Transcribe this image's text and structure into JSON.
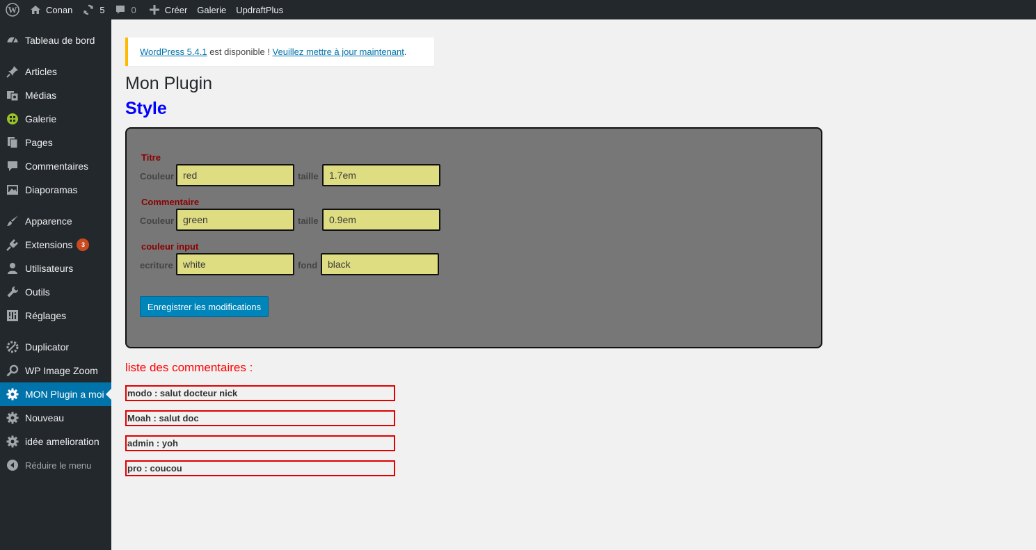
{
  "adminbar": {
    "site_name": "Conan",
    "updates_count": "5",
    "comments_count": "0",
    "new_label": "Créer",
    "galerie_label": "Galerie",
    "updraft_label": "UpdraftPlus"
  },
  "sidebar": {
    "items": [
      {
        "label": "Tableau de bord",
        "icon": "dashboard-icon"
      },
      {
        "label": "Articles",
        "icon": "pin-icon"
      },
      {
        "label": "Médias",
        "icon": "media-icon"
      },
      {
        "label": "Galerie",
        "icon": "gallery-icon"
      },
      {
        "label": "Pages",
        "icon": "pages-icon"
      },
      {
        "label": "Commentaires",
        "icon": "comments-icon"
      },
      {
        "label": "Diaporamas",
        "icon": "slideshow-icon"
      },
      {
        "label": "Apparence",
        "icon": "brush-icon"
      },
      {
        "label": "Extensions",
        "icon": "plugin-icon",
        "badge": "3"
      },
      {
        "label": "Utilisateurs",
        "icon": "user-icon"
      },
      {
        "label": "Outils",
        "icon": "wrench-icon"
      },
      {
        "label": "Réglages",
        "icon": "settings-icon"
      },
      {
        "label": "Duplicator",
        "icon": "duplicator-icon"
      },
      {
        "label": "WP Image Zoom",
        "icon": "zoom-icon"
      },
      {
        "label": "MON Plugin a moi",
        "icon": "gear-icon",
        "current": true
      },
      {
        "label": "Nouveau",
        "icon": "gear-icon"
      },
      {
        "label": "idée amelioration",
        "icon": "gear-icon"
      },
      {
        "label": "Réduire le menu",
        "icon": "collapse-icon"
      }
    ]
  },
  "notice": {
    "version_link": "WordPress 5.4.1",
    "middle_text": " est disponible ! ",
    "update_link": "Veuillez mettre à jour maintenant",
    "end_text": "."
  },
  "page": {
    "title": "Mon Plugin",
    "subtitle": "Style"
  },
  "form": {
    "titre": {
      "heading": "Titre",
      "color_label": "Couleur",
      "color_value": "red",
      "size_label": "taille",
      "size_value": "1.7em"
    },
    "commentaire": {
      "heading": "Commentaire",
      "color_label": "Couleur",
      "color_value": "green",
      "size_label": "taille",
      "size_value": "0.9em"
    },
    "input": {
      "heading": "couleur input",
      "text_label": "ecriture",
      "text_value": "white",
      "bg_label": "fond",
      "bg_value": "black"
    },
    "save_label": "Enregistrer les modifications"
  },
  "comments": {
    "title": "liste des commentaires :",
    "items": [
      "modo : salut docteur nick",
      "Moah : salut doc",
      "admin : yoh",
      "pro : coucou"
    ]
  },
  "colors": {
    "admin_dark": "#23282d",
    "accent": "#0073aa",
    "notice_border": "#ffb900",
    "style_title": "#0000ff",
    "group_title": "#8b0000",
    "input_bg": "#dedd82",
    "comment_border": "#e00000"
  }
}
